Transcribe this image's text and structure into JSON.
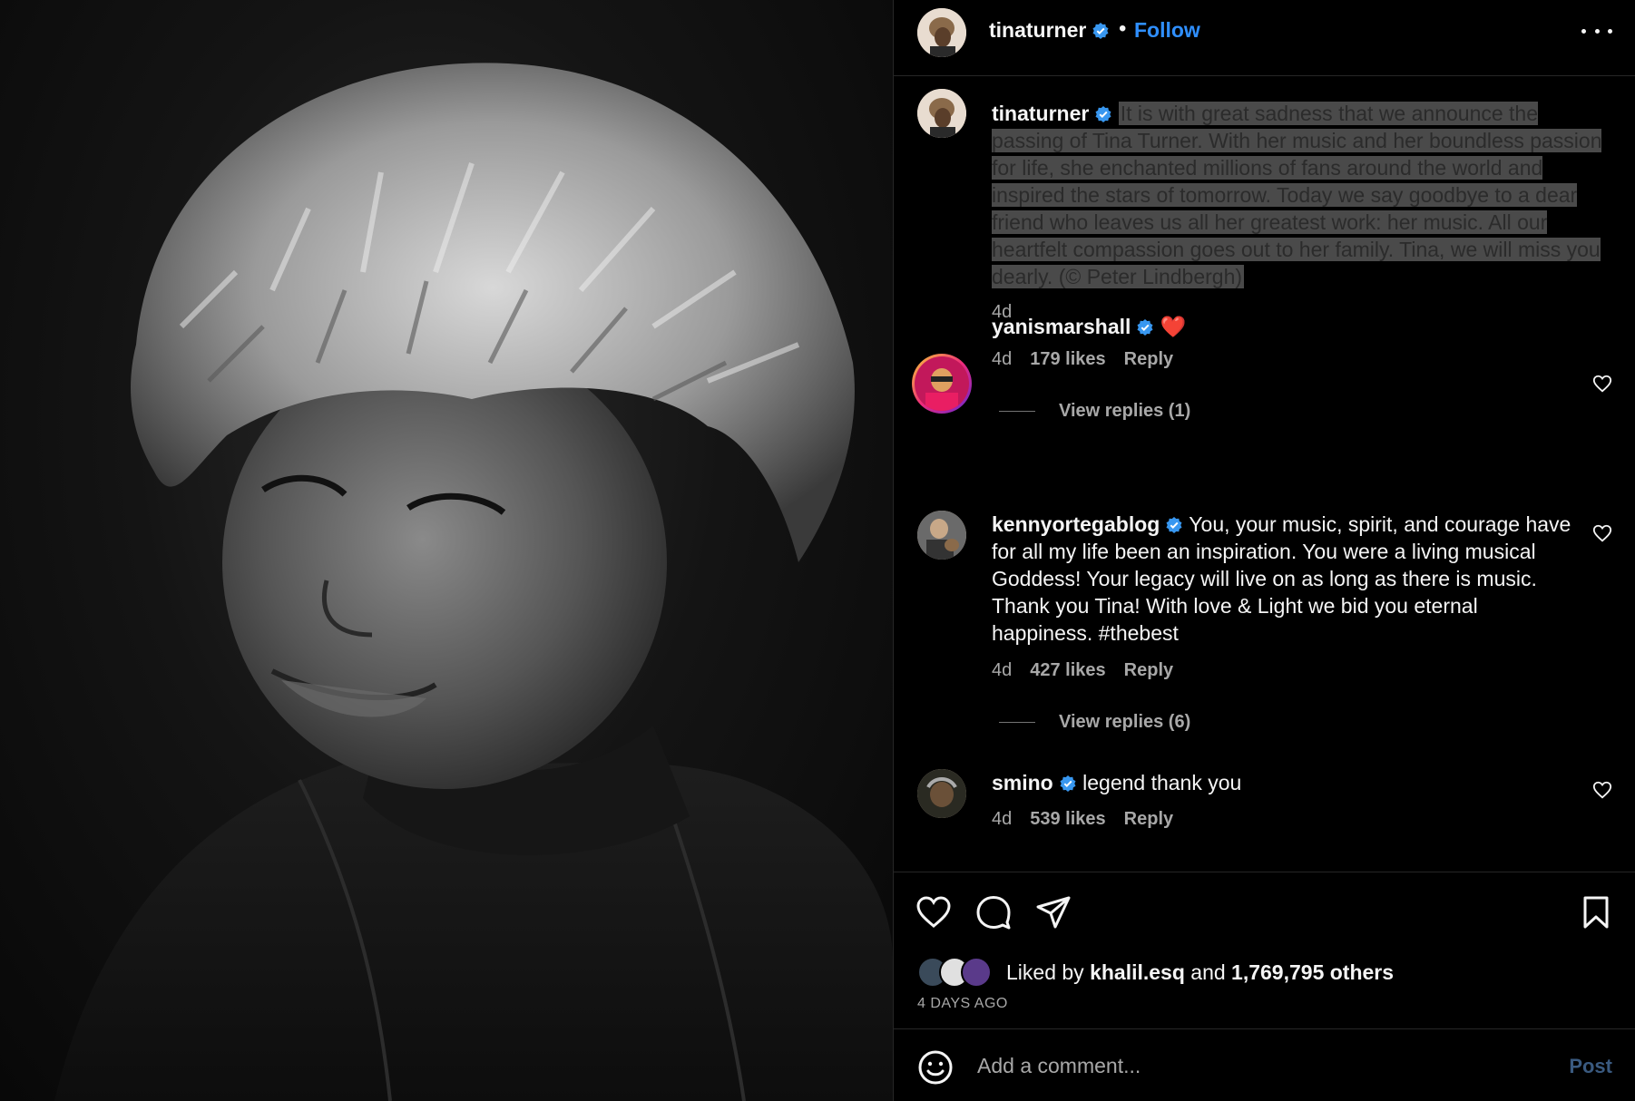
{
  "post": {
    "image_alt": "Black and white portrait of Tina Turner",
    "author": "tinaturner",
    "follow_label": "Follow",
    "separator": "•"
  },
  "caption": {
    "user": "tinaturner",
    "text": "It is with great sadness that we announce the passing of Tina Turner. With her music and her boundless passion for life, she enchanted millions of fans around the world and inspired the stars of tomorrow. Today we say goodbye to a dear friend who leaves us all her greatest work: her music. All our heartfelt compassion goes out to her family. Tina, we will miss you dearly. (© Peter Lindbergh)",
    "age": "4d"
  },
  "comments": [
    {
      "user": "yanismarshall",
      "text": "❤️",
      "age": "4d",
      "likes": "179 likes",
      "reply": "Reply",
      "view_replies": "View replies (1)"
    },
    {
      "user": "kennyortegablog",
      "text": "You, your music, spirit, and courage have for all my life been an inspiration. You were a living musical Goddess! Your legacy will live on as long as there is music. Thank you Tina! With love & Light we bid you eternal happiness. #thebest",
      "age": "4d",
      "likes": "427 likes",
      "reply": "Reply",
      "view_replies": "View replies (6)"
    },
    {
      "user": "smino",
      "text": "legend thank you",
      "age": "4d",
      "likes": "539 likes",
      "reply": "Reply"
    }
  ],
  "likes": {
    "prefix": "Liked by",
    "user": "khalil.esq",
    "conj": "and",
    "others": "1,769,795 others"
  },
  "timestamp": "4 DAYS AGO",
  "add_comment": {
    "placeholder": "Add a comment...",
    "post_label": "Post"
  },
  "colors": {
    "accent": "#2f8fff",
    "verified": "#3897f0",
    "muted": "#a8a8a8",
    "caption_highlight": "#4a4a4a"
  },
  "icons": [
    "more-options-icon",
    "verified-badge-icon",
    "heart-icon",
    "comment-icon",
    "share-icon",
    "bookmark-icon",
    "emoji-icon"
  ]
}
